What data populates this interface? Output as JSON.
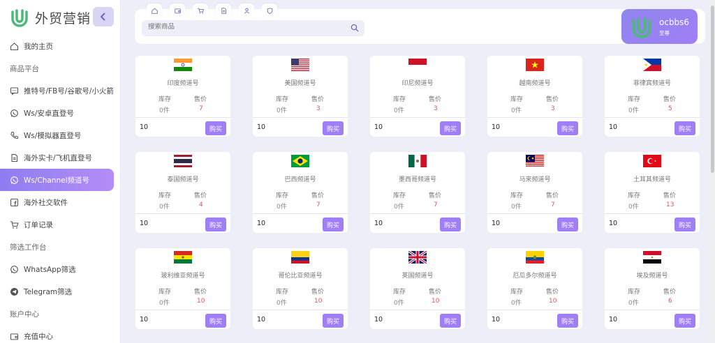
{
  "brand": {
    "name": "外贸营销",
    "accent": "#a07ef6",
    "logo_color": "#4cb97a"
  },
  "sidebar": {
    "items": [
      {
        "kind": "item",
        "icon": "home-icon",
        "label": "我的主页"
      },
      {
        "kind": "section",
        "label": "商品平台"
      },
      {
        "kind": "item",
        "icon": "chat-bubble-icon",
        "label": "推特号/FB号/谷歌号/小火箭"
      },
      {
        "kind": "item",
        "icon": "whatsapp-icon",
        "label": "Ws/安卓直登号"
      },
      {
        "kind": "item",
        "icon": "phone-icon",
        "label": "Ws/模拟器直登号"
      },
      {
        "kind": "item",
        "icon": "document-icon",
        "label": "海外实卡/飞机直登号"
      },
      {
        "kind": "item",
        "icon": "whatsapp-icon",
        "label": "Ws/Channel频道号",
        "active": true
      },
      {
        "kind": "item",
        "icon": "facebook-icon",
        "label": "海外社交软件"
      },
      {
        "kind": "item",
        "icon": "cart-icon",
        "label": "订单记录"
      },
      {
        "kind": "section",
        "label": "筛选工作台"
      },
      {
        "kind": "item",
        "icon": "whatsapp-icon",
        "label": "WhatsApp筛选"
      },
      {
        "kind": "item",
        "icon": "telegram-icon",
        "label": "Telegram筛选"
      },
      {
        "kind": "section",
        "label": "账户中心"
      },
      {
        "kind": "item",
        "icon": "wallet-icon",
        "label": "充值中心"
      }
    ]
  },
  "header": {
    "tab_icons": [
      "home-icon",
      "wallet-icon",
      "cart-icon",
      "document-icon",
      "user-icon",
      "shield-icon"
    ],
    "search_placeholder": "搜索商品",
    "user": {
      "name": "ocbbs6",
      "tier": "至尊"
    }
  },
  "products": {
    "stock_label": "库存",
    "price_label": "售价",
    "buy_label": "购买",
    "items": [
      {
        "name": "印度频道号",
        "flag": "india",
        "stock": "0件",
        "price": "7",
        "qty": "10"
      },
      {
        "name": "美国频道号",
        "flag": "usa",
        "stock": "0件",
        "price": "3",
        "qty": "10"
      },
      {
        "name": "印尼频道号",
        "flag": "indonesia",
        "stock": "0件",
        "price": "3",
        "qty": "10"
      },
      {
        "name": "越南频道号",
        "flag": "vietnam",
        "stock": "0件",
        "price": "3",
        "qty": "10"
      },
      {
        "name": "菲律宾频道号",
        "flag": "philippines",
        "stock": "0件",
        "price": "5",
        "qty": "10"
      },
      {
        "name": "泰国频道号",
        "flag": "thailand",
        "stock": "0件",
        "price": "4",
        "qty": "10"
      },
      {
        "name": "巴西频道号",
        "flag": "brazil",
        "stock": "0件",
        "price": "7",
        "qty": "10"
      },
      {
        "name": "墨西哥频道号",
        "flag": "mexico",
        "stock": "0件",
        "price": "7",
        "qty": "10"
      },
      {
        "name": "马来频道号",
        "flag": "malaysia",
        "stock": "0件",
        "price": "7",
        "qty": "10"
      },
      {
        "name": "土耳其频道号",
        "flag": "turkey",
        "stock": "0件",
        "price": "13",
        "qty": "10"
      },
      {
        "name": "玻利维亚频道号",
        "flag": "bolivia",
        "stock": "0件",
        "price": "10",
        "qty": "10"
      },
      {
        "name": "哥伦比亚频道号",
        "flag": "colombia",
        "stock": "0件",
        "price": "10",
        "qty": "10"
      },
      {
        "name": "英国频道号",
        "flag": "uk",
        "stock": "0件",
        "price": "10",
        "qty": "10"
      },
      {
        "name": "厄瓜多尔频道号",
        "flag": "ecuador",
        "stock": "0件",
        "price": "10",
        "qty": "10"
      },
      {
        "name": "埃及频道号",
        "flag": "egypt",
        "stock": "0件",
        "price": "6",
        "qty": "10"
      }
    ]
  }
}
